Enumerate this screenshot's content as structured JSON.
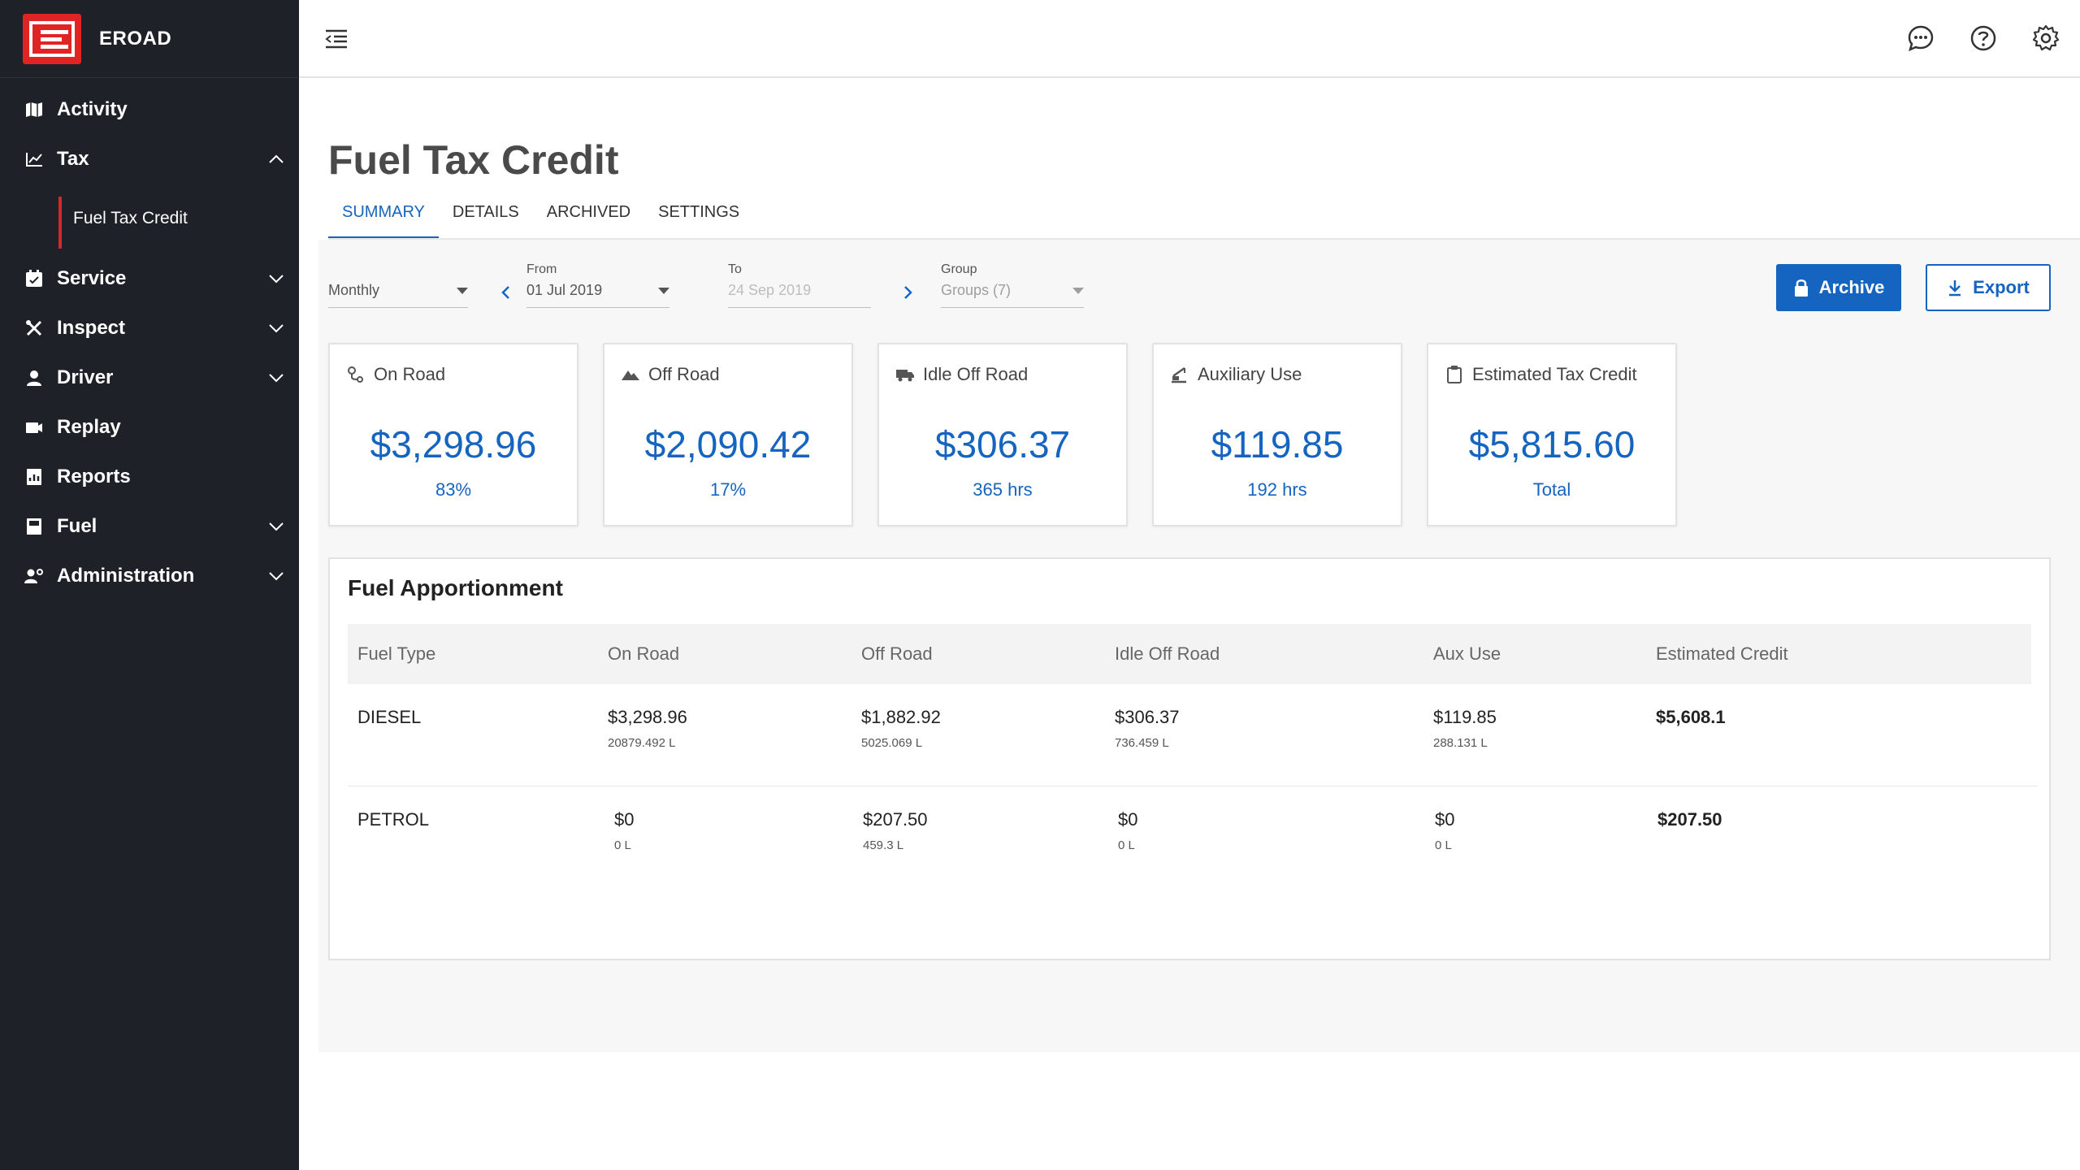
{
  "brand": {
    "name": "EROAD"
  },
  "sidebar": {
    "items": [
      {
        "label": "Activity",
        "icon": "map-icon"
      },
      {
        "label": "Tax",
        "icon": "chart-icon",
        "expanded": true,
        "children": [
          "Fuel Tax Credit"
        ]
      },
      {
        "label": "Service",
        "icon": "calendar-icon"
      },
      {
        "label": "Inspect",
        "icon": "tools-icon"
      },
      {
        "label": "Driver",
        "icon": "person-icon"
      },
      {
        "label": "Replay",
        "icon": "video-icon"
      },
      {
        "label": "Reports",
        "icon": "report-icon"
      },
      {
        "label": "Fuel",
        "icon": "fuel-icon"
      },
      {
        "label": "Administration",
        "icon": "admin-icon"
      }
    ]
  },
  "header": {
    "title": "Fuel Tax Credit"
  },
  "tabs": [
    "SUMMARY",
    "DETAILS",
    "ARCHIVED",
    "SETTINGS"
  ],
  "filters": {
    "period": {
      "value": "Monthly"
    },
    "from": {
      "label": "From",
      "value": "01 Jul 2019"
    },
    "to": {
      "label": "To",
      "value": "24 Sep 2019"
    },
    "group": {
      "label": "Group",
      "value": "Groups (7)"
    }
  },
  "actions": {
    "archive": "Archive",
    "export": "Export"
  },
  "cards": [
    {
      "title": "On Road",
      "value": "$3,298.96",
      "sub": "83%"
    },
    {
      "title": "Off Road",
      "value": "$2,090.42",
      "sub": "17%"
    },
    {
      "title": "Idle Off Road",
      "value": "$306.37",
      "sub": "365 hrs"
    },
    {
      "title": "Auxiliary Use",
      "value": "$119.85",
      "sub": "192 hrs"
    },
    {
      "title": "Estimated Tax Credit",
      "value": "$5,815.60",
      "sub": "Total"
    }
  ],
  "table": {
    "title": "Fuel Apportionment",
    "columns": [
      "Fuel Type",
      "On Road",
      "Off Road",
      "Idle Off Road",
      "Aux Use",
      "Estimated Credit"
    ],
    "rows": [
      {
        "fuel": "DIESEL",
        "on_road": {
          "amount": "$3,298.96",
          "litres": "20879.492 L"
        },
        "off_road": {
          "amount": "$1,882.92",
          "litres": "5025.069 L"
        },
        "idle": {
          "amount": "$306.37",
          "litres": "736.459 L"
        },
        "aux": {
          "amount": "$119.85",
          "litres": "288.131 L"
        },
        "credit": "$5,608.1"
      },
      {
        "fuel": "PETROL",
        "on_road": {
          "amount": "$0",
          "litres": "0 L"
        },
        "off_road": {
          "amount": "$207.50",
          "litres": "459.3 L"
        },
        "idle": {
          "amount": "$0",
          "litres": "0 L"
        },
        "aux": {
          "amount": "$0",
          "litres": "0 L"
        },
        "credit": "$207.50"
      }
    ]
  },
  "colors": {
    "accent": "#1565c0",
    "brand": "#e02424",
    "sidebar": "#1e2127"
  }
}
